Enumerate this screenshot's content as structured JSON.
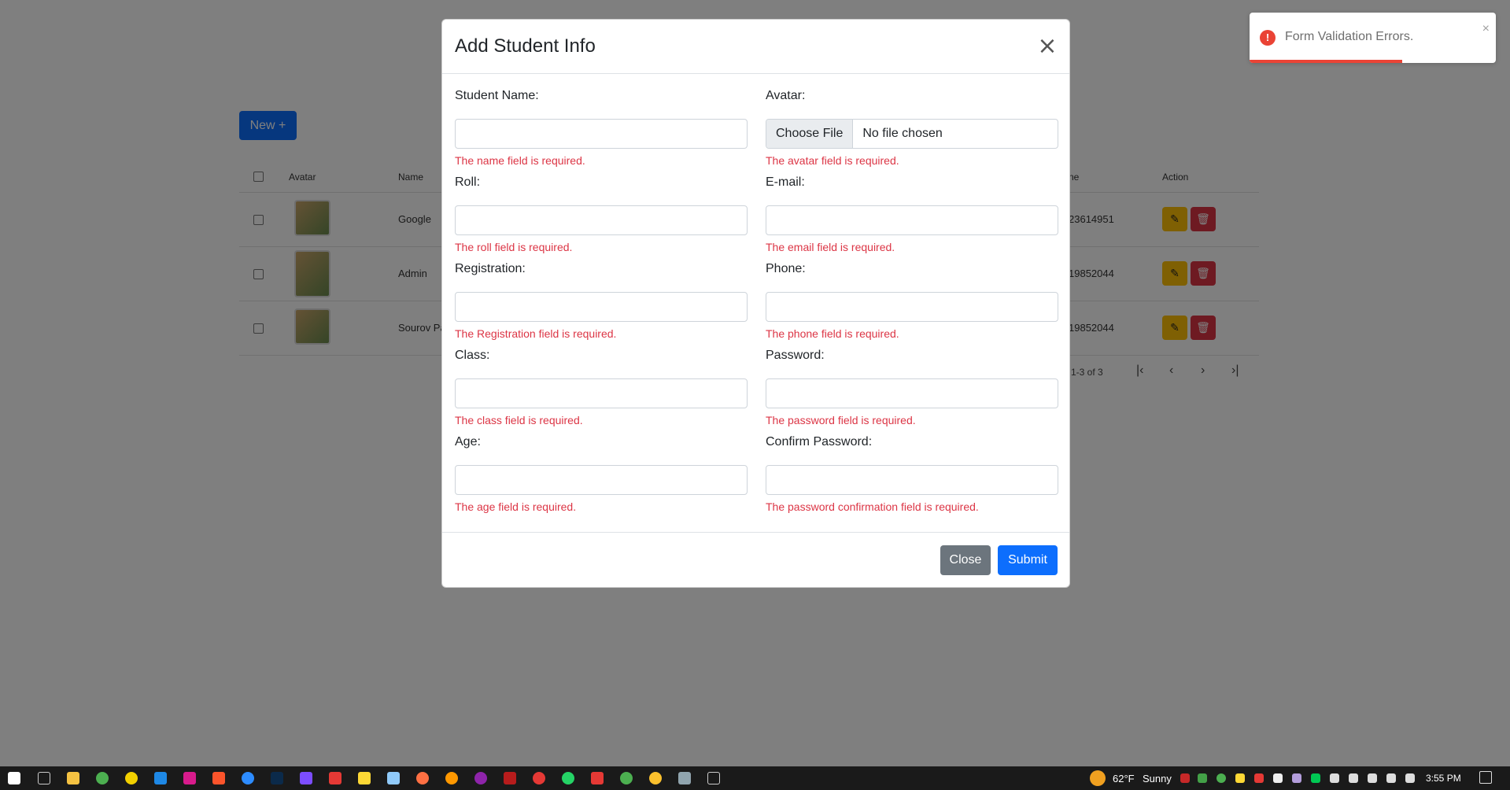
{
  "page": {
    "new_button": "New +",
    "table": {
      "headers": {
        "avatar": "Avatar",
        "name": "Name",
        "phone_partial": "ne",
        "action": "Action"
      },
      "rows": [
        {
          "name": "Google",
          "phone": "23614951"
        },
        {
          "name": "Admin",
          "phone": "19852044"
        },
        {
          "name": "Sourov Pa",
          "phone": "19852044"
        }
      ]
    },
    "pagination": {
      "range": "1-3 of 3"
    }
  },
  "modal": {
    "title": "Add Student Info",
    "fields": {
      "student_name": {
        "label": "Student Name:",
        "error": "The name field is required."
      },
      "avatar": {
        "label": "Avatar:",
        "button": "Choose File",
        "value": "No file chosen",
        "error": "The avatar field is required."
      },
      "roll": {
        "label": "Roll:",
        "error": "The roll field is required."
      },
      "email": {
        "label": "E-mail:",
        "error": "The email field is required."
      },
      "registration": {
        "label": "Registration:",
        "error": "The Registration field is required."
      },
      "phone": {
        "label": "Phone:",
        "error": "The phone field is required."
      },
      "class": {
        "label": "Class:",
        "error": "The class field is required."
      },
      "password": {
        "label": "Password:",
        "error": "The password field is required."
      },
      "age": {
        "label": "Age:",
        "error": "The age field is required."
      },
      "confirm_password": {
        "label": "Confirm Password:",
        "error": "The password confirmation field is required."
      }
    },
    "footer": {
      "close": "Close",
      "submit": "Submit"
    }
  },
  "toast": {
    "message": "Form Validation Errors.",
    "icon": "!",
    "progress": 0.62
  },
  "taskbar": {
    "weather_temp": "62°F",
    "weather_text": "Sunny",
    "time": "3:55 PM"
  },
  "colors": {
    "primary": "#0d6efd",
    "secondary": "#6c757d",
    "danger": "#dc3545",
    "warning": "#ffc107",
    "toast_error": "#ea4335"
  }
}
